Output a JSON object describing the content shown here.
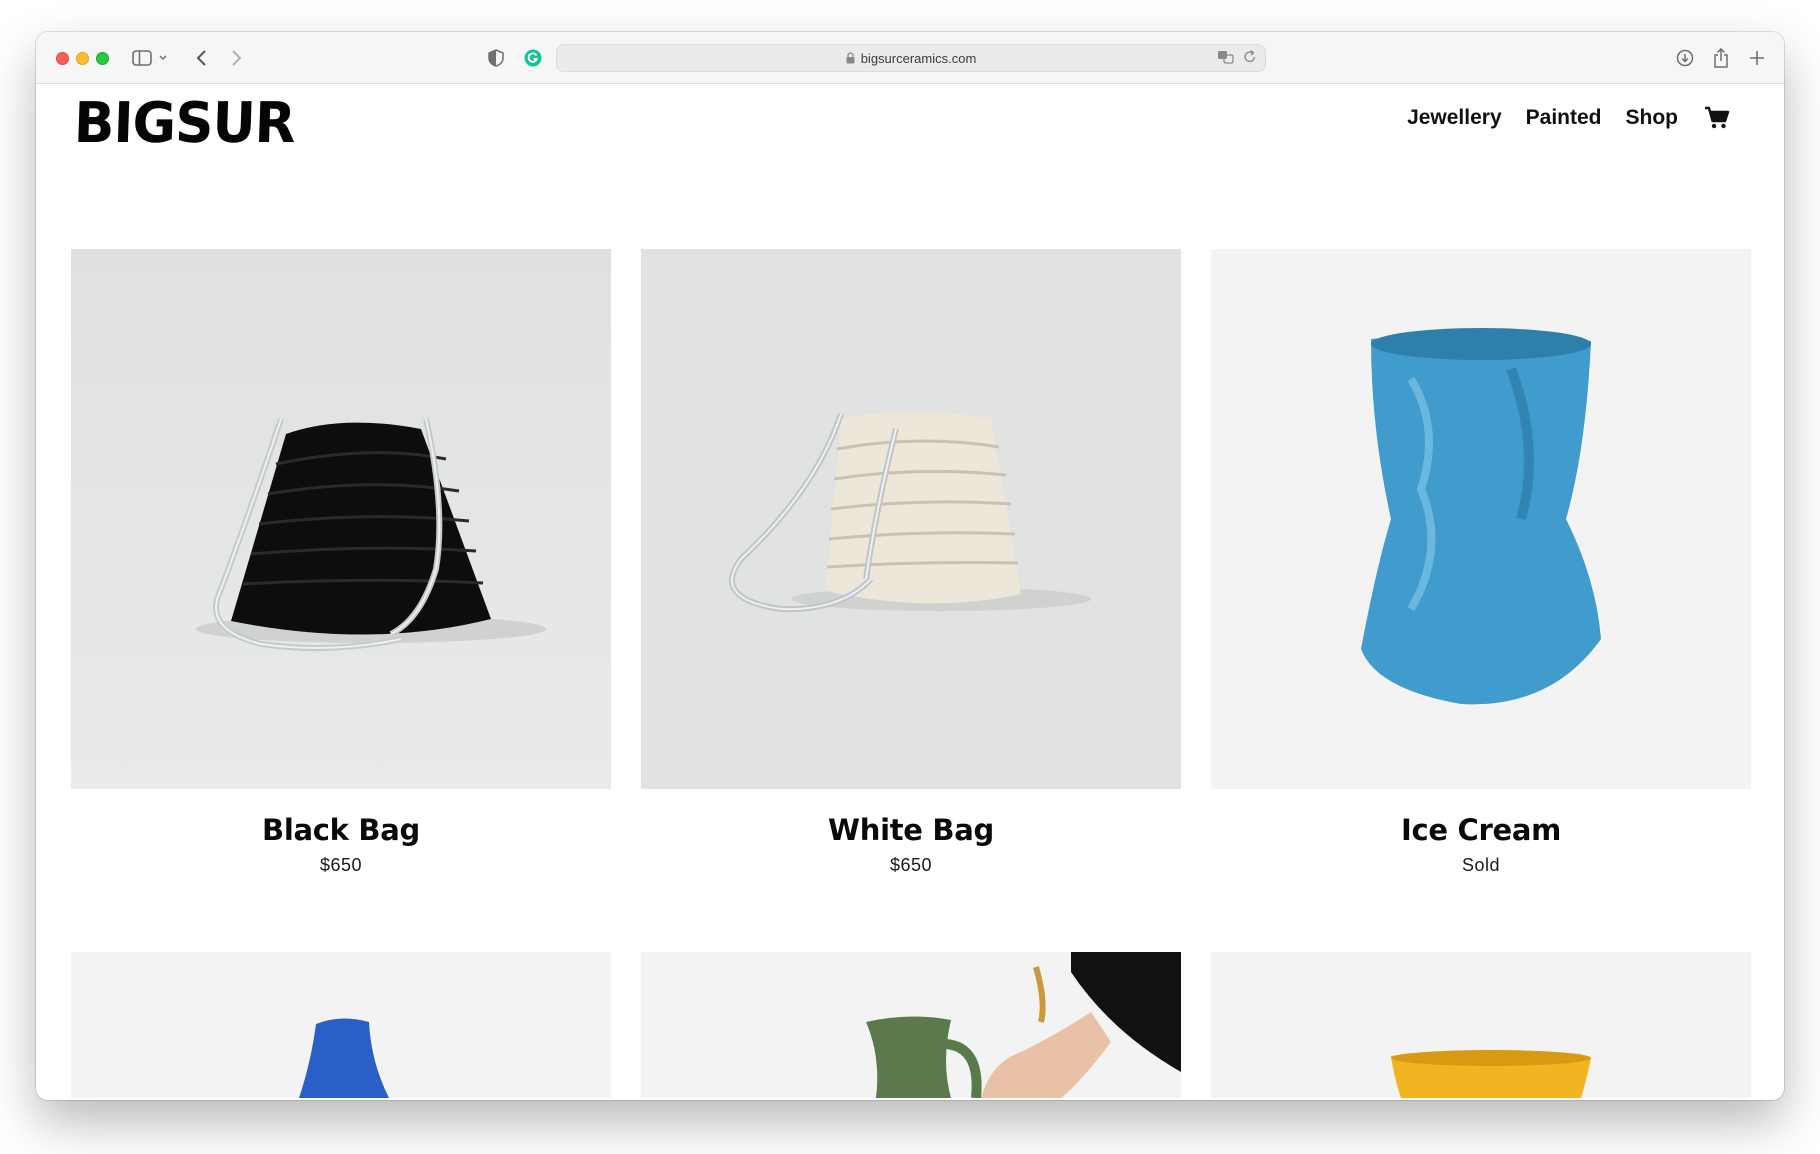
{
  "browser": {
    "url": "bigsurceramics.com"
  },
  "site": {
    "logo": "BIGSUR",
    "nav": [
      {
        "label": "Jewellery"
      },
      {
        "label": "Painted"
      },
      {
        "label": "Shop"
      }
    ]
  },
  "products": [
    {
      "title": "Black Bag",
      "price": "$650"
    },
    {
      "title": "White Bag",
      "price": "$650"
    },
    {
      "title": "Ice Cream",
      "price": "Sold"
    }
  ],
  "colors": {
    "ice_cream_glaze": "#3f9ccc",
    "blue_vase": "#2a5fc8",
    "green_jug": "#5a7a4c",
    "yellow_bowl": "#f2b420"
  }
}
